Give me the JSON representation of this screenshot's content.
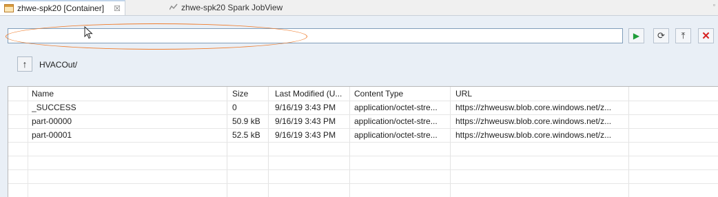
{
  "tabs": [
    {
      "label": "zhwe-spk20 [Container]",
      "icon": "container-icon",
      "close_glyph": "☒"
    },
    {
      "label": "zhwe-spk20 Spark JobView",
      "icon": "spark-icon"
    }
  ],
  "window_controls": {
    "minimize": "▫"
  },
  "path_field": {
    "value": "",
    "placeholder": ""
  },
  "toolbar": {
    "run_icon": "▶",
    "refresh_icon": "⟳",
    "upload_icon": "⤒",
    "stop_icon": "✕"
  },
  "navigation": {
    "up_icon": "↑",
    "current_folder": "HVACOut/"
  },
  "table": {
    "columns": [
      "Name",
      "Size",
      "Last Modified (U...",
      "Content Type",
      "URL"
    ],
    "rows": [
      {
        "name": "_SUCCESS",
        "size": "0",
        "modified": "9/16/19 3:43 PM",
        "content_type": "application/octet-stre...",
        "url": "https://zhweusw.blob.core.windows.net/z..."
      },
      {
        "name": "part-00000",
        "size": "50.9 kB",
        "modified": "9/16/19 3:43 PM",
        "content_type": "application/octet-stre...",
        "url": "https://zhweusw.blob.core.windows.net/z..."
      },
      {
        "name": "part-00001",
        "size": "52.5 kB",
        "modified": "9/16/19 3:43 PM",
        "content_type": "application/octet-stre...",
        "url": "https://zhweusw.blob.core.windows.net/z..."
      }
    ]
  },
  "colors": {
    "highlight_oval": "#ef7c2c",
    "run_green": "#1f9d3a",
    "stop_red": "#d62020",
    "background": "#e9eff6"
  }
}
